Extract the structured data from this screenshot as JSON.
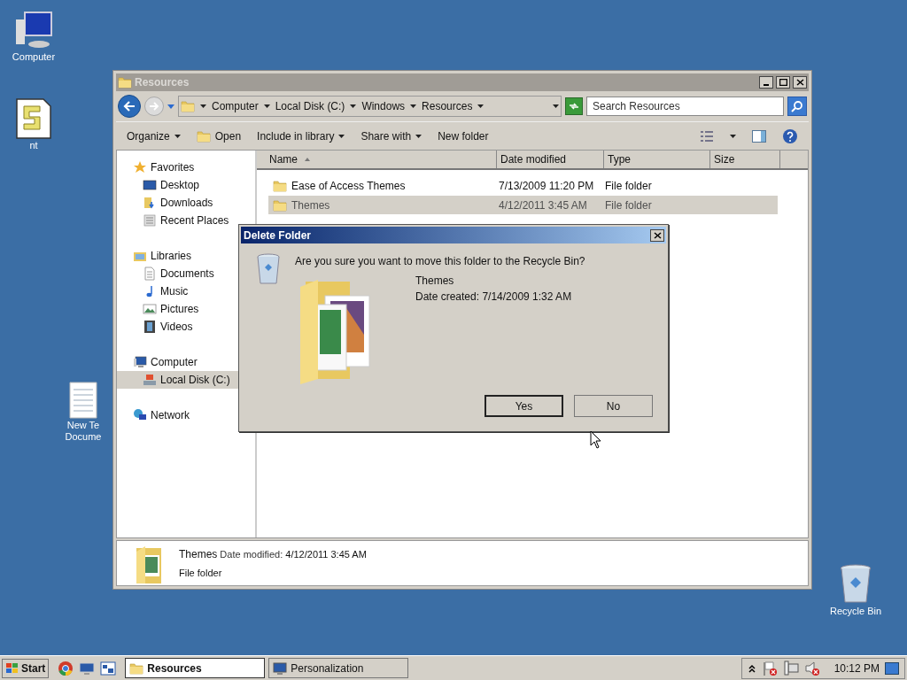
{
  "desktop_icons": [
    {
      "kind": "computer",
      "lines": [
        "Computer"
      ]
    },
    {
      "kind": "script",
      "lines": [
        "nt"
      ]
    },
    {
      "kind": "document",
      "lines": [
        "New Te",
        "Docume"
      ]
    },
    {
      "kind": "bin",
      "lines": [
        "Recycle Bin"
      ]
    }
  ],
  "explorer": {
    "title": "Resources",
    "breadcrumb": [
      "Computer",
      "Local Disk (C:)",
      "Windows",
      "Resources"
    ],
    "search": {
      "placeholder": "Search Resources"
    },
    "toolbar": [
      {
        "label": "Organize",
        "kind": "menu"
      },
      {
        "label": "Open",
        "kind": "open"
      },
      {
        "label": "Include in library",
        "kind": "menu"
      },
      {
        "label": "Share with",
        "kind": "menu"
      },
      {
        "label": "New folder",
        "kind": "plain"
      }
    ],
    "nav": [
      {
        "label": "Favorites",
        "kind": "star",
        "selected": false,
        "children": [
          {
            "label": "Desktop",
            "kind": "desktop",
            "selected": false
          },
          {
            "label": "Downloads",
            "kind": "downloads",
            "selected": false
          },
          {
            "label": "Recent Places",
            "kind": "recent",
            "selected": false
          }
        ]
      },
      {
        "label": "Libraries",
        "kind": "library",
        "selected": false,
        "children": [
          {
            "label": "Documents",
            "kind": "documents",
            "selected": false
          },
          {
            "label": "Music",
            "kind": "music",
            "selected": false
          },
          {
            "label": "Pictures",
            "kind": "pictures",
            "selected": false
          },
          {
            "label": "Videos",
            "kind": "videos",
            "selected": false
          }
        ]
      },
      {
        "label": "Computer",
        "kind": "computer",
        "selected": false,
        "children": [
          {
            "label": "Local Disk (C:)",
            "kind": "disk",
            "selected": true
          }
        ]
      },
      {
        "label": "Network",
        "kind": "network",
        "selected": false
      }
    ],
    "columns": [
      {
        "label": "Name",
        "sorted": true
      },
      {
        "label": "Date modified",
        "sorted": false
      },
      {
        "label": "Type",
        "sorted": false
      },
      {
        "label": "Size",
        "sorted": false
      }
    ],
    "rows": [
      {
        "name": "Ease of Access Themes",
        "date": "7/13/2009 11:20 PM",
        "type": "File folder",
        "selected": false
      },
      {
        "name": "Themes",
        "date": "4/12/2011 3:45 AM",
        "type": "File folder",
        "selected": true
      }
    ],
    "details": {
      "name": "Themes",
      "meta_label": "Date modified:",
      "meta_value": "4/12/2011 3:45 AM",
      "type": "File folder"
    }
  },
  "dialog": {
    "title": "Delete Folder",
    "question": "Are you sure you want to move this folder to the Recycle Bin?",
    "item_name": "Themes",
    "item_detail": "Date created: 7/14/2009 1:32 AM",
    "buttons": [
      {
        "label": "Yes",
        "default": true
      },
      {
        "label": "No",
        "default": false
      }
    ]
  },
  "taskbar": {
    "start": "Start",
    "quick_launch": [
      {
        "kind": "chrome"
      },
      {
        "kind": "desktop"
      },
      {
        "kind": "explorer"
      }
    ],
    "tasks": [
      {
        "label": "Resources",
        "kind": "folder",
        "selected": true
      },
      {
        "label": "Personalization",
        "kind": "display",
        "selected": false
      }
    ],
    "tray": [
      {
        "kind": "flag"
      },
      {
        "kind": "network"
      },
      {
        "kind": "speaker"
      }
    ],
    "clock": "10:12 PM"
  }
}
